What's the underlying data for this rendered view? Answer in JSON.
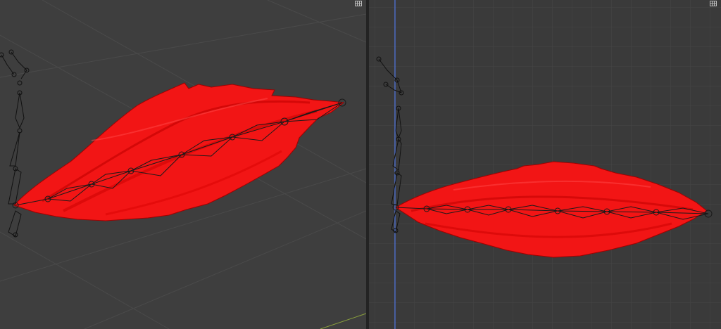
{
  "viewports": {
    "left": {
      "view": "perspective",
      "corner_icon": "viewport-split-icon"
    },
    "right": {
      "view": "orthographic",
      "corner_icon": "viewport-split-icon",
      "grid": true
    }
  },
  "colors": {
    "viewport_bg_left": "#3e3e3e",
    "viewport_bg_right": "#3a3a3a",
    "grid_line": "#454545",
    "mesh_red": "#ff1a1a",
    "mesh_dark_red": "#b80000",
    "armature_line": "#111111",
    "z_axis": "#4f7cff",
    "x_axis": "#9ab040"
  },
  "objects": {
    "mesh": "red-feather-mesh",
    "armature": "bone-chain-armature",
    "rig": "side-figure-armature"
  }
}
